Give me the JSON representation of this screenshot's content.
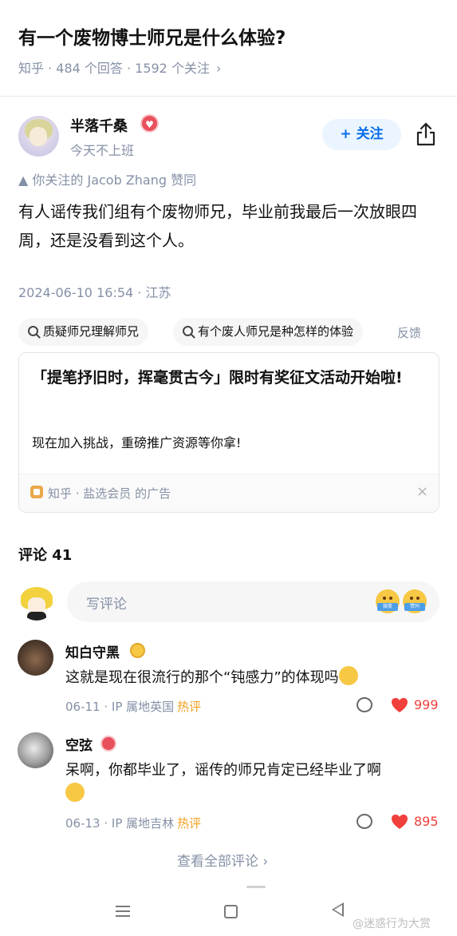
{
  "question": {
    "title": "有一个废物博士师兄是什么体验?",
    "meta": "知乎 · 484 个回答 · 1592 个关注",
    "meta_chevron": "›"
  },
  "author": {
    "name": "半落千桑",
    "bio": "今天不上班",
    "follow_label": "+ 关注",
    "badge_icon": "♥"
  },
  "answer": {
    "upvote_line": "▲ 你关注的 Jacob Zhang 赞同",
    "text": "有人谣传我们组有个废物师兄，毕业前我最后一次放眼四周，还是没看到这个人。",
    "date": "2024-06-10 16:54 · 江苏"
  },
  "related_searches": [
    {
      "label": "质疑师兄理解师兄"
    },
    {
      "label": "有个废人师兄是种怎样的体验"
    }
  ],
  "feedback_label": "反馈",
  "ad": {
    "title": "「提笔抒旧时，挥毫贯古今」限时有奖征文活动开始啦!",
    "description": "现在加入挑战，重磅推广资源等你拿!",
    "source": "知乎 · 盐选会员 的广告",
    "close": "×"
  },
  "comments": {
    "header": "评论 41",
    "input_placeholder": "写评论",
    "emoji_labels": [
      "微笑",
      "赞同"
    ],
    "items": [
      {
        "name": "知白守黑",
        "text": "这就是现在很流行的那个“钝感力”的体现吗",
        "date_location": "06-11 · IP 属地英国",
        "hot": "热评",
        "likes": "999"
      },
      {
        "name": "空弦",
        "text": "呆啊，你都毕业了，谣传的师兄肯定已经毕业了啊",
        "date_location": "06-13 · IP 属地吉林",
        "hot": "热评",
        "likes": "895"
      }
    ],
    "view_all": "查看全部评论 ›"
  },
  "watermark": "@迷惑行为大赏",
  "colors": {
    "brand_blue": "#056de8",
    "meta_gray": "#8590a6",
    "like_red": "#f1403c",
    "hot_orange": "#f0a020"
  },
  "icons": {
    "share": "share-icon",
    "search": "search-icon",
    "reply": "comment-bubble-icon",
    "like": "heart-icon"
  }
}
